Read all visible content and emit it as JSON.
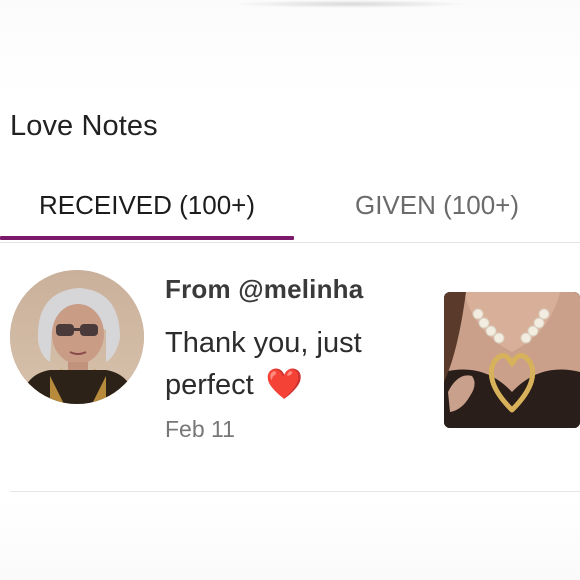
{
  "header": {
    "title": "Love Notes"
  },
  "tabs": [
    {
      "label": "RECEIVED (100+)",
      "active": true
    },
    {
      "label": "GIVEN (100+)",
      "active": false
    }
  ],
  "accent_color": "#7b1a6a",
  "note": {
    "sender": "From @melinha",
    "message": "Thank you, just perfect",
    "emoji": "❤️",
    "date": "Feb 11",
    "avatar_icon": "user-avatar",
    "thumbnail_icon": "product-thumbnail"
  }
}
